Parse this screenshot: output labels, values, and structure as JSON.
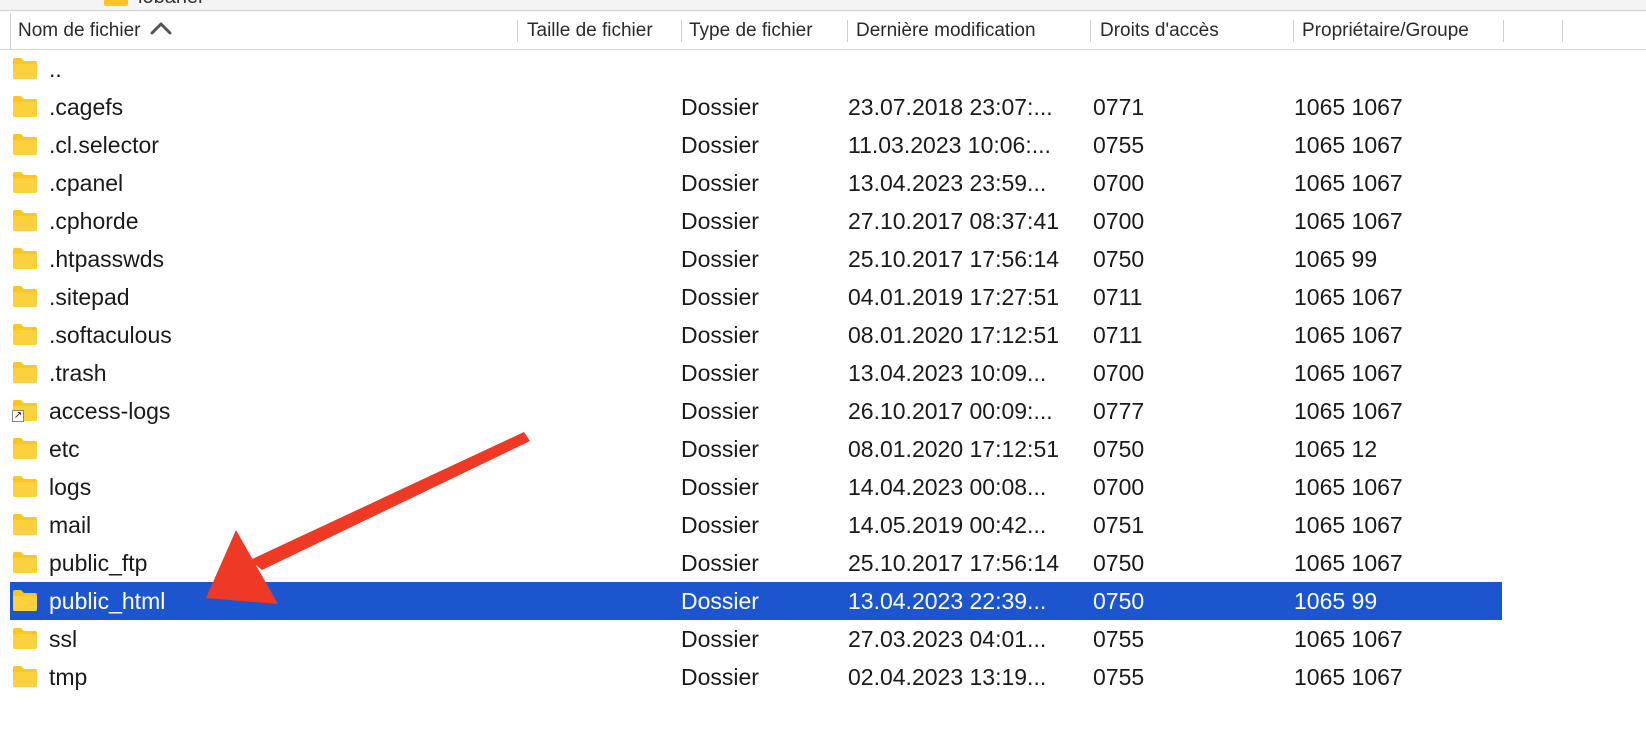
{
  "top_partial_label": "lobaner",
  "columns": [
    {
      "key": "name",
      "label": "Nom de fichier"
    },
    {
      "key": "size",
      "label": "Taille de fichier"
    },
    {
      "key": "type",
      "label": "Type de fichier"
    },
    {
      "key": "modified",
      "label": "Dernière modification"
    },
    {
      "key": "perms",
      "label": "Droits d'accès"
    },
    {
      "key": "owner",
      "label": "Propriétaire/Groupe"
    }
  ],
  "sort_icon": "chevron-up-icon",
  "selected_color": "#1d55cf",
  "folder_color": "#f9c623",
  "arrow_color": "#ee3a24",
  "rows": [
    {
      "name": "..",
      "size": "",
      "type": "",
      "modified": "",
      "perms": "",
      "owner": "",
      "icon": "folder-icon"
    },
    {
      "name": ".cagefs",
      "size": "",
      "type": "Dossier",
      "modified": "23.07.2018 23:07:...",
      "perms": "0771",
      "owner": "1065 1067",
      "icon": "folder-icon"
    },
    {
      "name": ".cl.selector",
      "size": "",
      "type": "Dossier",
      "modified": "11.03.2023 10:06:...",
      "perms": "0755",
      "owner": "1065 1067",
      "icon": "folder-icon"
    },
    {
      "name": ".cpanel",
      "size": "",
      "type": "Dossier",
      "modified": "13.04.2023 23:59...",
      "perms": "0700",
      "owner": "1065 1067",
      "icon": "folder-icon"
    },
    {
      "name": ".cphorde",
      "size": "",
      "type": "Dossier",
      "modified": "27.10.2017 08:37:41",
      "perms": "0700",
      "owner": "1065 1067",
      "icon": "folder-icon"
    },
    {
      "name": ".htpasswds",
      "size": "",
      "type": "Dossier",
      "modified": "25.10.2017 17:56:14",
      "perms": "0750",
      "owner": "1065 99",
      "icon": "folder-icon"
    },
    {
      "name": ".sitepad",
      "size": "",
      "type": "Dossier",
      "modified": "04.01.2019 17:27:51",
      "perms": "0711",
      "owner": "1065 1067",
      "icon": "folder-icon"
    },
    {
      "name": ".softaculous",
      "size": "",
      "type": "Dossier",
      "modified": "08.01.2020 17:12:51",
      "perms": "0711",
      "owner": "1065 1067",
      "icon": "folder-icon"
    },
    {
      "name": ".trash",
      "size": "",
      "type": "Dossier",
      "modified": "13.04.2023 10:09...",
      "perms": "0700",
      "owner": "1065 1067",
      "icon": "folder-icon"
    },
    {
      "name": "access-logs",
      "size": "",
      "type": "Dossier",
      "modified": "26.10.2017 00:09:...",
      "perms": "0777",
      "owner": "1065 1067",
      "icon": "folder-link-icon"
    },
    {
      "name": "etc",
      "size": "",
      "type": "Dossier",
      "modified": "08.01.2020 17:12:51",
      "perms": "0750",
      "owner": "1065 12",
      "icon": "folder-icon"
    },
    {
      "name": "logs",
      "size": "",
      "type": "Dossier",
      "modified": "14.04.2023 00:08...",
      "perms": "0700",
      "owner": "1065 1067",
      "icon": "folder-icon"
    },
    {
      "name": "mail",
      "size": "",
      "type": "Dossier",
      "modified": "14.05.2019 00:42...",
      "perms": "0751",
      "owner": "1065 1067",
      "icon": "folder-icon"
    },
    {
      "name": "public_ftp",
      "size": "",
      "type": "Dossier",
      "modified": "25.10.2017 17:56:14",
      "perms": "0750",
      "owner": "1065 1067",
      "icon": "folder-icon"
    },
    {
      "name": "public_html",
      "size": "",
      "type": "Dossier",
      "modified": "13.04.2023 22:39...",
      "perms": "0750",
      "owner": "1065 99",
      "icon": "folder-icon",
      "selected": true
    },
    {
      "name": "ssl",
      "size": "",
      "type": "Dossier",
      "modified": "27.03.2023 04:01...",
      "perms": "0755",
      "owner": "1065 1067",
      "icon": "folder-icon"
    },
    {
      "name": "tmp",
      "size": "",
      "type": "Dossier",
      "modified": "02.04.2023 13:19...",
      "perms": "0755",
      "owner": "1065 1067",
      "icon": "folder-icon"
    }
  ]
}
